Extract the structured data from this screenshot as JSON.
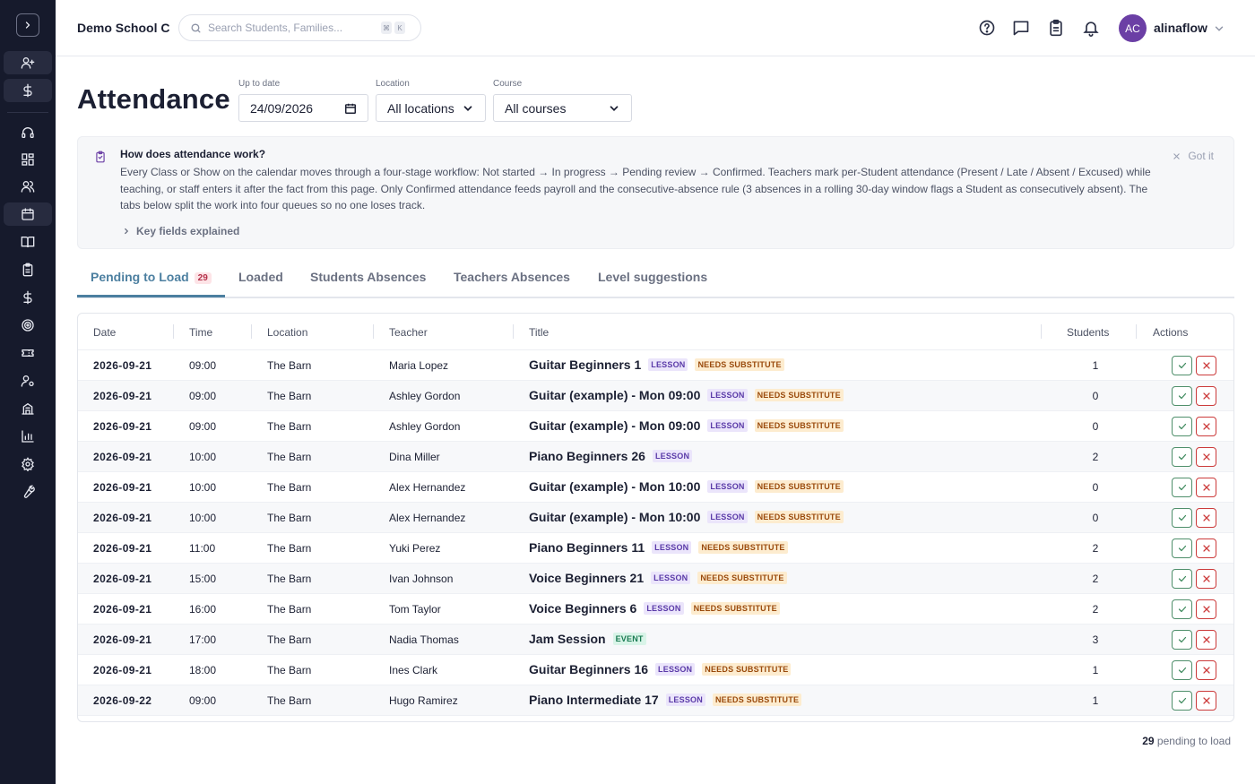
{
  "header": {
    "school": "Demo School C",
    "search_placeholder": "Search Students, Families...",
    "kbd": [
      "⌘",
      "K"
    ],
    "user_initials": "AC",
    "username": "alinaflow"
  },
  "page": {
    "title": "Attendance",
    "filters": {
      "date_label": "Up to date",
      "date_value": "24/09/2026",
      "location_label": "Location",
      "location_value": "All locations",
      "course_label": "Course",
      "course_value": "All courses"
    }
  },
  "info": {
    "title": "How does attendance work?",
    "body": "Every Class or Show on the calendar moves through a four-stage workflow: Not started → In progress → Pending review → Confirmed. Teachers mark per-Student attendance (Present / Late / Absent / Excused) while teaching, or staff enters it after the fact from this page. Only Confirmed attendance feeds payroll and the consecutive-absence rule (3 absences in a rolling 30-day window flags a Student as consecutively absent). The tabs below split the work into four queues so no one loses track.",
    "dismiss": "Got it",
    "key_fields": "Key fields explained"
  },
  "tabs": [
    {
      "label": "Pending to Load",
      "count": "29"
    },
    {
      "label": "Loaded"
    },
    {
      "label": "Students Absences"
    },
    {
      "label": "Teachers Absences"
    },
    {
      "label": "Level suggestions"
    }
  ],
  "table": {
    "headers": {
      "date": "Date",
      "time": "Time",
      "location": "Location",
      "teacher": "Teacher",
      "title": "Title",
      "students": "Students",
      "actions": "Actions"
    },
    "rows": [
      {
        "date": "2026-09-21",
        "time": "09:00",
        "location": "The Barn",
        "teacher": "Maria Lopez",
        "title": "Guitar Beginners 1",
        "badges": [
          "LESSON",
          "NEEDS SUBSTITUTE"
        ],
        "students": "1"
      },
      {
        "date": "2026-09-21",
        "time": "09:00",
        "location": "The Barn",
        "teacher": "Ashley Gordon",
        "title": "Guitar (example) - Mon 09:00",
        "badges": [
          "LESSON",
          "NEEDS SUBSTITUTE"
        ],
        "students": "0"
      },
      {
        "date": "2026-09-21",
        "time": "09:00",
        "location": "The Barn",
        "teacher": "Ashley Gordon",
        "title": "Guitar (example) - Mon 09:00",
        "badges": [
          "LESSON",
          "NEEDS SUBSTITUTE"
        ],
        "students": "0"
      },
      {
        "date": "2026-09-21",
        "time": "10:00",
        "location": "The Barn",
        "teacher": "Dina Miller",
        "title": "Piano Beginners 26",
        "badges": [
          "LESSON"
        ],
        "students": "2"
      },
      {
        "date": "2026-09-21",
        "time": "10:00",
        "location": "The Barn",
        "teacher": "Alex Hernandez",
        "title": "Guitar (example) - Mon 10:00",
        "badges": [
          "LESSON",
          "NEEDS SUBSTITUTE"
        ],
        "students": "0"
      },
      {
        "date": "2026-09-21",
        "time": "10:00",
        "location": "The Barn",
        "teacher": "Alex Hernandez",
        "title": "Guitar (example) - Mon 10:00",
        "badges": [
          "LESSON",
          "NEEDS SUBSTITUTE"
        ],
        "students": "0"
      },
      {
        "date": "2026-09-21",
        "time": "11:00",
        "location": "The Barn",
        "teacher": "Yuki Perez",
        "title": "Piano Beginners 11",
        "badges": [
          "LESSON",
          "NEEDS SUBSTITUTE"
        ],
        "students": "2"
      },
      {
        "date": "2026-09-21",
        "time": "15:00",
        "location": "The Barn",
        "teacher": "Ivan Johnson",
        "title": "Voice Beginners 21",
        "badges": [
          "LESSON",
          "NEEDS SUBSTITUTE"
        ],
        "students": "2"
      },
      {
        "date": "2026-09-21",
        "time": "16:00",
        "location": "The Barn",
        "teacher": "Tom Taylor",
        "title": "Voice Beginners 6",
        "badges": [
          "LESSON",
          "NEEDS SUBSTITUTE"
        ],
        "students": "2"
      },
      {
        "date": "2026-09-21",
        "time": "17:00",
        "location": "The Barn",
        "teacher": "Nadia Thomas",
        "title": "Jam Session",
        "badges": [
          "EVENT"
        ],
        "students": "3"
      },
      {
        "date": "2026-09-21",
        "time": "18:00",
        "location": "The Barn",
        "teacher": "Ines Clark",
        "title": "Guitar Beginners 16",
        "badges": [
          "LESSON",
          "NEEDS SUBSTITUTE"
        ],
        "students": "1"
      },
      {
        "date": "2026-09-22",
        "time": "09:00",
        "location": "The Barn",
        "teacher": "Hugo Ramirez",
        "title": "Piano Intermediate 17",
        "badges": [
          "LESSON",
          "NEEDS SUBSTITUTE"
        ],
        "students": "1"
      }
    ]
  },
  "footer": {
    "count": "29",
    "text": "pending to load"
  },
  "colors": {
    "sidebar": "#161a2c",
    "accent": "#4c7fa0",
    "avatar": "#6b3fa5",
    "confirm": "#3f8a5e",
    "reject": "#cc3b3b"
  },
  "sidebar_icons": [
    "chevron-right-icon",
    "add-user-icon",
    "dollar-icon",
    "headset-icon",
    "dashboard-icon",
    "users-icon",
    "calendar-icon",
    "book-icon",
    "clipboard-icon",
    "dollar-icon",
    "target-icon",
    "ticket-icon",
    "user-settings-icon",
    "building-icon",
    "chart-icon",
    "gear-icon",
    "wrench-icon"
  ]
}
